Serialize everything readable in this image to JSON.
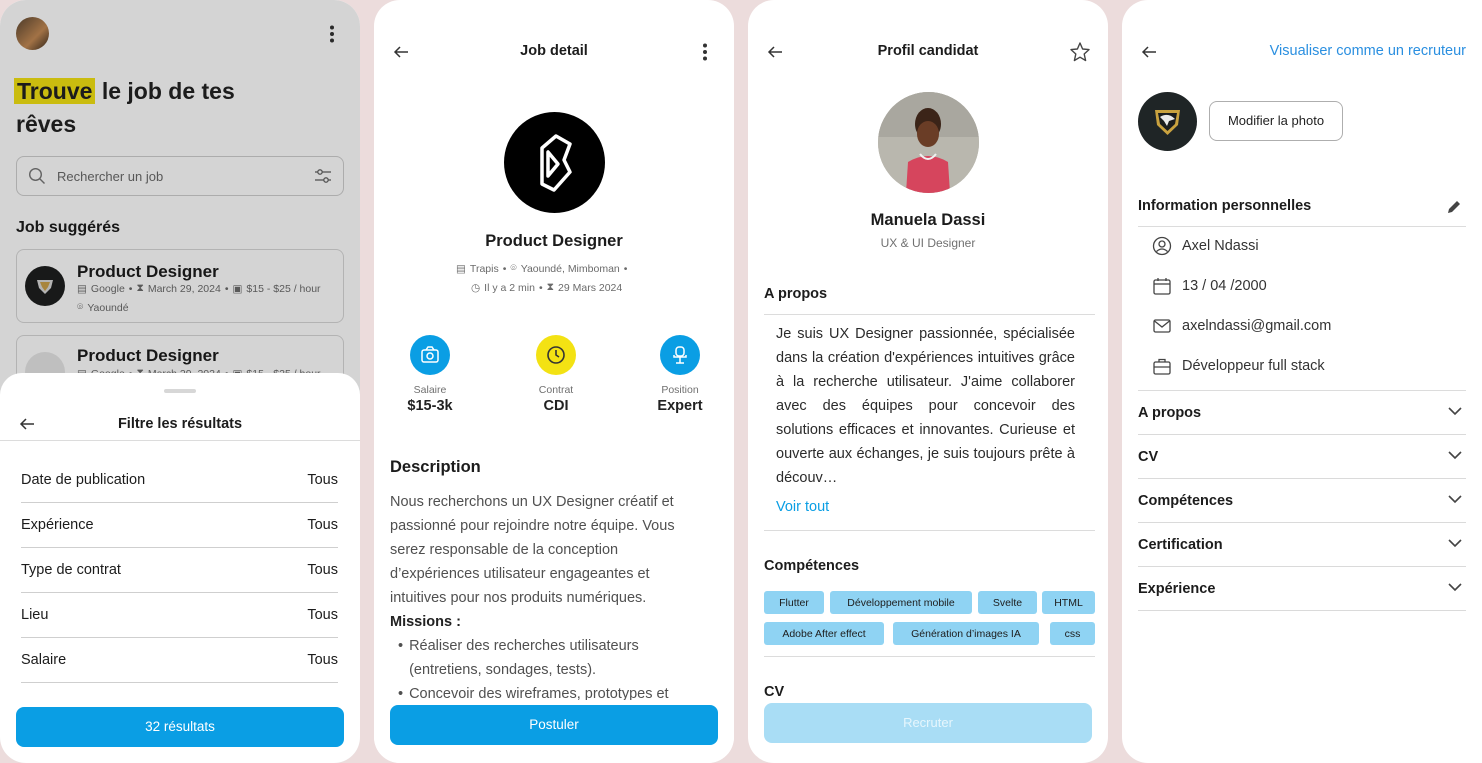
{
  "colors": {
    "primary": "#0a9ee4",
    "highlight": "#f3e213",
    "salary_icon_bg": "#0a9ee4",
    "contract_icon_bg": "#f3e213",
    "position_icon_bg": "#0a9ee4",
    "chip_bg": "#8fd3f3",
    "link": "#2a8fe0"
  },
  "search_screen": {
    "hero_highlight": "Trouve",
    "hero_rest_line1": "le job de tes",
    "hero_line2": "rêves",
    "search_placeholder": "Rechercher un job",
    "suggested_title": "Job suggérés",
    "jobs": [
      {
        "title": "Product Designer",
        "company": "Google",
        "date": "March 29, 2024",
        "salary": "$15 - $25 / hour",
        "location": "Yaoundé"
      },
      {
        "title": "Product Designer",
        "company": "Google",
        "date": "March 29, 2024",
        "salary": "$15 - $25 / hour"
      }
    ],
    "filter": {
      "title": "Filtre les résultats",
      "rows": [
        {
          "label": "Date de publication",
          "value": "Tous"
        },
        {
          "label": "Expérience",
          "value": "Tous"
        },
        {
          "label": "Type de contrat",
          "value": "Tous"
        },
        {
          "label": "Lieu",
          "value": "Tous"
        },
        {
          "label": "Salaire",
          "value": "Tous"
        }
      ],
      "results_button": "32 résultats"
    }
  },
  "job_detail": {
    "header": "Job detail",
    "title": "Product Designer",
    "company": "Trapis",
    "location": "Yaoundé, Mimboman",
    "posted": "Il y a 2 min",
    "deadline": "29 Mars 2024",
    "stats": [
      {
        "label": "Salaire",
        "value": "$15-3k",
        "icon": "money-icon"
      },
      {
        "label": "Contrat",
        "value": "CDI",
        "icon": "clock-icon"
      },
      {
        "label": "Position",
        "value": "Expert",
        "icon": "chair-icon"
      }
    ],
    "description_title": "Description",
    "description": "Nous recherchons un UX Designer créatif et passionné pour rejoindre notre équipe. Vous serez responsable de la conception d’expériences utilisateur engageantes et intuitives pour nos produits numériques.",
    "missions_title": "Missions :",
    "missions": [
      "Réaliser des recherches utilisateurs (entretiens, sondages, tests).",
      "Concevoir des wireframes, prototypes et"
    ],
    "apply_button": "Postuler"
  },
  "candidate": {
    "header": "Profil candidat",
    "name": "Manuela Dassi",
    "role": "UX & UI Designer",
    "about_title": "A propos",
    "about_text": "Je suis UX Designer passionnée, spécialisée dans la création d'expériences intuitives grâce à la recherche utilisateur. J'aime collaborer avec des équipes pour concevoir des solutions efficaces et innovantes. Curieuse et ouverte aux échanges, je suis toujours prête à découv…",
    "see_all": "Voir tout",
    "skills_title": "Compétences",
    "skills": [
      "Flutter",
      "Développement mobile",
      "Svelte",
      "HTML",
      "Adobe After effect",
      "Génération d’images IA",
      "css"
    ],
    "cv_title": "CV",
    "recruit_button": "Recruter"
  },
  "profile": {
    "view_as_recruiter": "Visualiser comme un recruteur",
    "change_photo": "Modifier la photo",
    "personal_info_title": "Information  personnelles",
    "name": "Axel Ndassi",
    "birthdate": "13 / 04 /2000",
    "email": "axelndassi@gmail.com",
    "job": "Développeur full stack",
    "sections": [
      "A propos",
      "CV",
      "Compétences",
      "Certification",
      "Expérience"
    ]
  }
}
